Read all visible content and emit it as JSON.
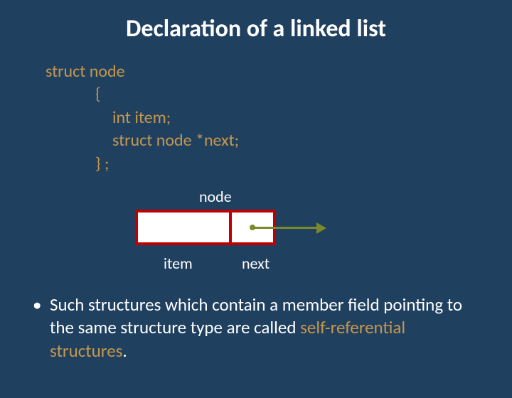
{
  "title": "Declaration of a linked list",
  "code": {
    "l1": "struct  node",
    "l2": "{",
    "l3": "int   item;",
    "l4": "struct node  *next;",
    "l5": "} ;"
  },
  "diagram": {
    "node_label": "node",
    "item_label": "item",
    "next_label": "next"
  },
  "bullet": {
    "mark": "•",
    "pre": "Such structures which contain a member field pointing to the same structure type are called ",
    "hl": "self-referential structures",
    "post": "."
  }
}
